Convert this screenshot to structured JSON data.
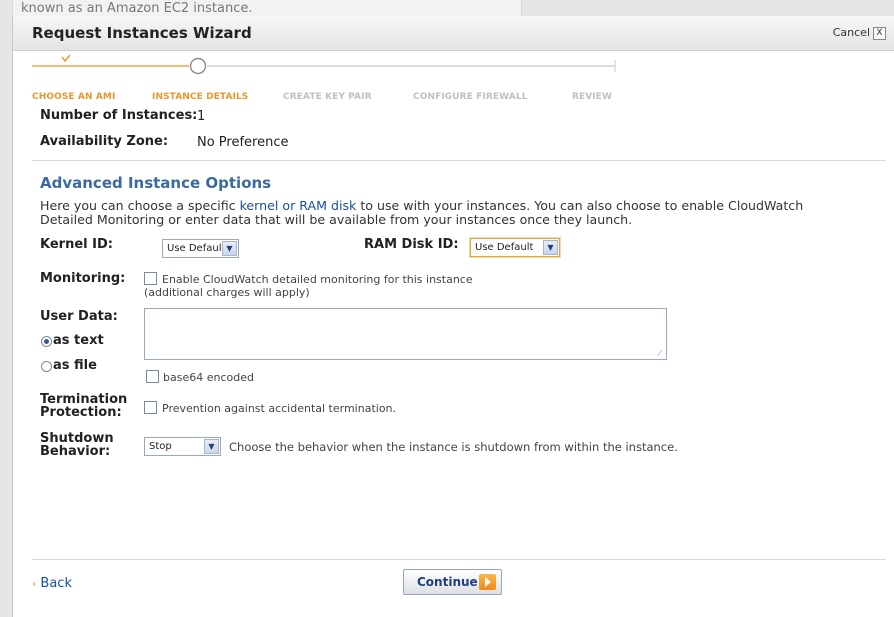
{
  "background": {
    "text": "known as an Amazon EC2 instance."
  },
  "dialog": {
    "title": "Request Instances Wizard",
    "cancel_label": "Cancel",
    "close_glyph": "X"
  },
  "steps": [
    {
      "label": "CHOOSE AN AMI",
      "state": "done"
    },
    {
      "label": "INSTANCE DETAILS",
      "state": "active"
    },
    {
      "label": "CREATE KEY PAIR",
      "state": "pending"
    },
    {
      "label": "CONFIGURE FIREWALL",
      "state": "pending"
    },
    {
      "label": "REVIEW",
      "state": "pending"
    }
  ],
  "summary": {
    "instances_label": "Number of Instances:",
    "instances_value": "1",
    "zone_label": "Availability Zone:",
    "zone_value": "No Preference"
  },
  "advanced": {
    "heading": "Advanced Instance Options",
    "desc_pre": "Here you can choose a specific ",
    "desc_link": "kernel or RAM disk",
    "desc_post": " to use with your instances. You can also choose to enable CloudWatch Detailed Monitoring or enter data that will be available from your instances once they launch.",
    "kernel_label": "Kernel ID:",
    "kernel_value": "Use Default",
    "ramdisk_label": "RAM Disk ID:",
    "ramdisk_value": "Use Default",
    "monitoring_label": "Monitoring:",
    "monitoring_checkbox": "Enable CloudWatch detailed monitoring for this instance",
    "monitoring_note": "(additional charges will apply)",
    "userdata_label": "User Data:",
    "as_text": "as text",
    "as_file": "as file",
    "userdata_mode": "as text",
    "base64_label": "base64 encoded",
    "termination_label_1": "Termination",
    "termination_label_2": "Protection:",
    "termination_checkbox": "Prevention against accidental termination.",
    "shutdown_label_1": "Shutdown",
    "shutdown_label_2": "Behavior:",
    "shutdown_value": "Stop",
    "shutdown_desc": "Choose the behavior when the instance is shutdown from within the instance."
  },
  "footer": {
    "back_label": "Back",
    "back_glyph": "‹",
    "continue_label": "Continue"
  },
  "colors": {
    "accent": "#e8962c",
    "link": "#1a4fa0",
    "heading": "#3a6aa0"
  }
}
